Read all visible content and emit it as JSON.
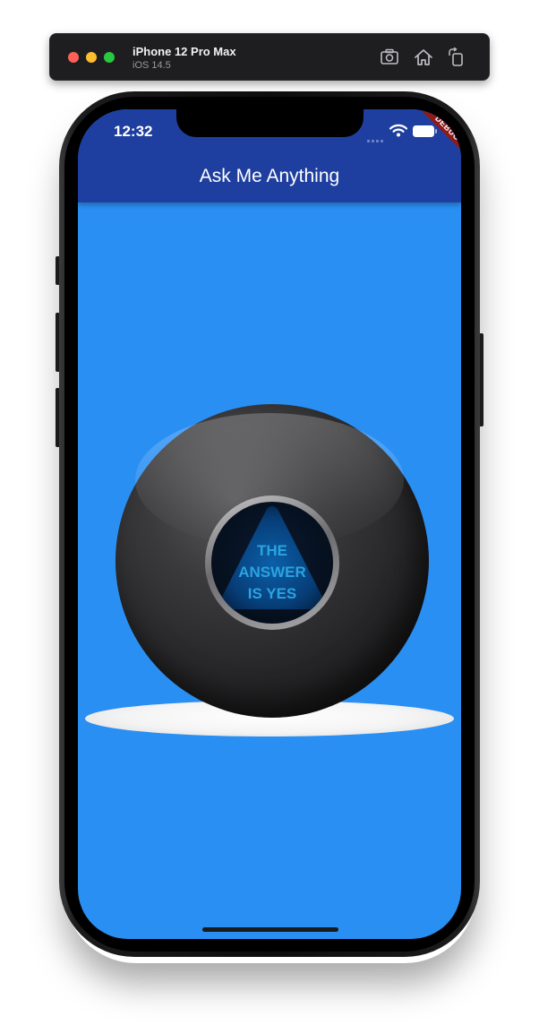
{
  "simulator": {
    "device_name": "iPhone 12 Pro Max",
    "os_version": "iOS 14.5",
    "icons": [
      "screenshot-icon",
      "home-icon",
      "rotate-icon"
    ]
  },
  "status_bar": {
    "time": "12:32",
    "icons": [
      "cellular-signal-icon",
      "wifi-icon",
      "battery-icon"
    ]
  },
  "app_bar": {
    "title": "Ask Me Anything",
    "background_color": "#1f3fa0"
  },
  "debug_banner": {
    "label": "DEBUG",
    "color": "#8e1b1b"
  },
  "body": {
    "background_color": "#2a8ff2",
    "magic_ball": {
      "answer_lines": [
        "THE",
        "ANSWER",
        "IS YES"
      ],
      "text_color": "#2aa3e0"
    }
  }
}
